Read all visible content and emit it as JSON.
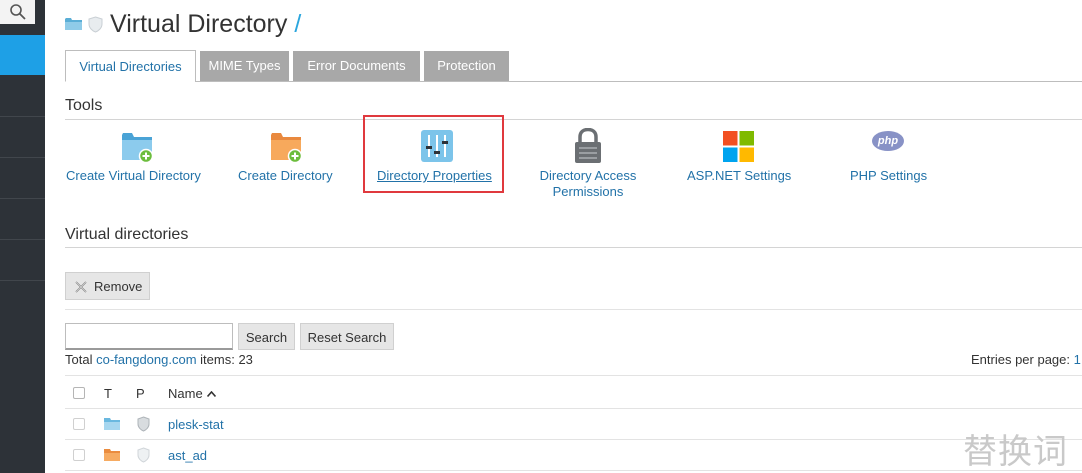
{
  "title": {
    "text": "Virtual Directory",
    "suffix": "/"
  },
  "tabs": [
    {
      "label": "Virtual Directories",
      "active": true
    },
    {
      "label": "MIME Types",
      "active": false
    },
    {
      "label": "Error Documents",
      "active": false
    },
    {
      "label": "Protection",
      "active": false
    }
  ],
  "tools": {
    "heading": "Tools",
    "items": [
      {
        "label": "Create Virtual Directory",
        "icon": "folder-add-icon"
      },
      {
        "label": "Create Directory",
        "icon": "folder-add-icon"
      },
      {
        "label": "Directory Properties",
        "icon": "sliders-icon"
      },
      {
        "label_line1": "Directory Access",
        "label_line2": "Permissions",
        "icon": "lock-icon"
      },
      {
        "label": "ASP.NET Settings",
        "icon": "windows-icon"
      },
      {
        "label": "PHP Settings",
        "icon": "php-icon",
        "badge": "php"
      }
    ]
  },
  "virtual_directories": {
    "heading": "Virtual directories",
    "remove_label": "Remove",
    "search_label": "Search",
    "reset_search_label": "Reset Search",
    "total_prefix": "Total",
    "domain": "co-fangdong.com",
    "items_text": "items: 23",
    "entries_per_page_label": "Entries per page:",
    "entries_per_page_value": "1",
    "columns": {
      "t": "T",
      "p": "P",
      "name": "Name"
    },
    "rows": [
      {
        "name": "plesk-stat",
        "folder": "blue"
      },
      {
        "name": "ast_ad",
        "folder": "orange"
      }
    ]
  },
  "watermark": "替换词",
  "colors": {
    "sidebar": "#2d3238",
    "accent": "#1ea0e6",
    "link": "#2272a8",
    "highlight": "#e0393e"
  }
}
